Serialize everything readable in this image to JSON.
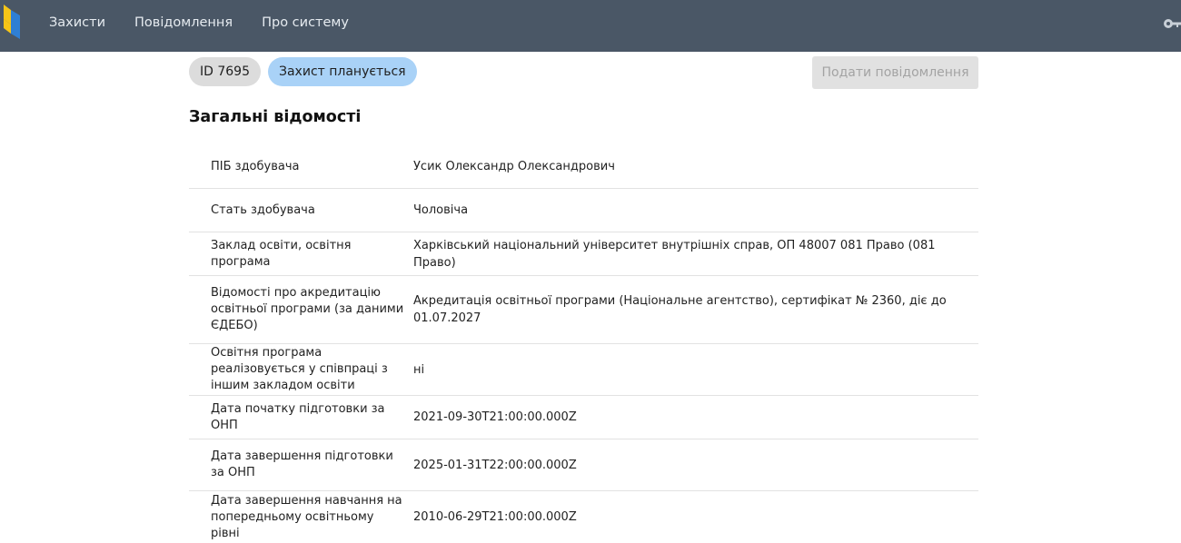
{
  "nav": {
    "items": [
      "Захисти",
      "Повідомлення",
      "Про систему"
    ]
  },
  "header_icons": {
    "logo": "logo-icon",
    "account": "key-icon"
  },
  "badges": {
    "id": "ID 7695",
    "status": "Захист планується"
  },
  "actions": {
    "submit_label": "Подати повідомлення"
  },
  "section": {
    "title": "Загальні відомості"
  },
  "rows": [
    {
      "label": "ПІБ здобувача",
      "value": "Усик Олександр Олександрович"
    },
    {
      "label": "Стать здобувача",
      "value": "Чоловіча"
    },
    {
      "label": "Заклад освіти, освітня програма",
      "value": "Харківський національний університет внутрішніх справ, ОП 48007 081 Право (081 Право)"
    },
    {
      "label": "Відомості про акредитацію освітньої програми (за даними ЄДЕБО)",
      "value": "Акредитація освітньої програми (Національне агентство), сертифікат № 2360, діє до 01.07.2027"
    },
    {
      "label": "Освітня програма реалізовується у співпраці з іншим закладом освіти",
      "value": "ні"
    },
    {
      "label": "Дата початку підготовки за ОНП",
      "value": "2021-09-30T21:00:00.000Z"
    },
    {
      "label": "Дата завершення підготовки за ОНП",
      "value": "2025-01-31T22:00:00.000Z"
    },
    {
      "label": "Дата завершення навчання на попередньому освітньому рівні",
      "value": "2010-06-29T21:00:00.000Z"
    }
  ],
  "colors": {
    "topbar": "#4a5766",
    "status_badge": "#a9d2f7",
    "logo_blue": "#2f7fd4",
    "logo_yellow": "#f5c518"
  }
}
